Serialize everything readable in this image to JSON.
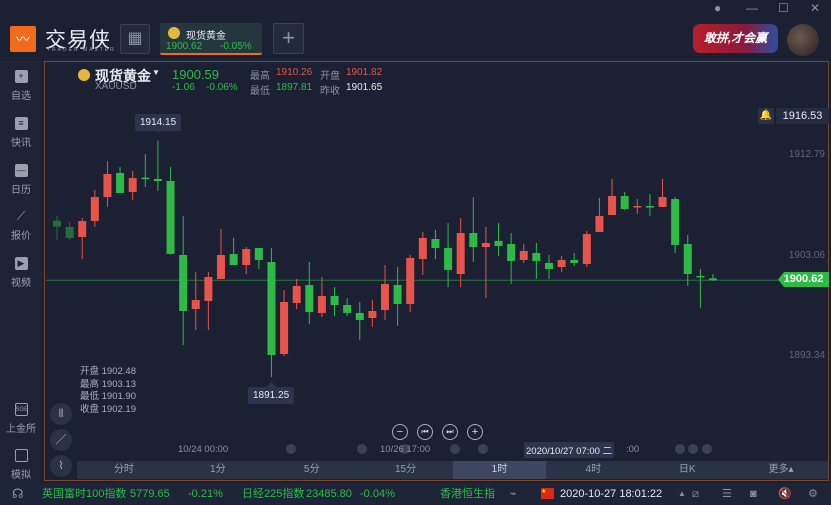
{
  "app": {
    "brand": "交易侠",
    "brand_sub": "TRADER MASTER",
    "banner": "敢拼,才会赢"
  },
  "tab": {
    "name": "现货黄金",
    "price": "1900.62",
    "change": "-0.05%"
  },
  "sidebar": {
    "items": [
      {
        "label": "自选",
        "icon": "bookmark-icon"
      },
      {
        "label": "快讯",
        "icon": "news-icon"
      },
      {
        "label": "日历",
        "icon": "calendar-icon"
      },
      {
        "label": "报价",
        "icon": "quote-icon"
      },
      {
        "label": "视频",
        "icon": "video-icon"
      },
      {
        "label": "上金所",
        "icon": "sge-icon"
      },
      {
        "label": "模拟",
        "icon": "wallet-icon"
      }
    ]
  },
  "quote": {
    "name": "现货黄金",
    "symbol": "XAUUSD",
    "price": "1900.59",
    "change": "-1.06",
    "change_pct": "-0.06%",
    "high_label": "最高",
    "high": "1910.26",
    "open_label": "开盘",
    "open": "1901.82",
    "low_label": "最低",
    "low": "1897.81",
    "prev_label": "昨收",
    "prev": "1901.65"
  },
  "ohlc_panel": {
    "open": "开盘 1902.48",
    "high": "最高 1903.13",
    "low": "最低 1901.90",
    "close": "收盘 1902.19"
  },
  "chart_data": {
    "type": "candlestick",
    "y_ticks": [
      "1912.79",
      "1903.06",
      "1893.34"
    ],
    "y_tick_values": [
      1912.79,
      1903.06,
      1893.34
    ],
    "top_label": "1916.53",
    "current_price": "1900.62",
    "max_label": "1914.15",
    "min_label": "1891.25",
    "x_labels": [
      "10/24 00:00",
      "10/26 17:00"
    ],
    "crosshair_time": "2020/10/27 07:00 二",
    "crosshair_tail": ":00",
    "colors": {
      "up": "#e8534a",
      "down": "#2dbb45"
    },
    "candles": [
      [
        1906.38,
        1906.84,
        1904.51,
        1905.8
      ],
      [
        1905.77,
        1906.25,
        1904.51,
        1904.71
      ],
      [
        1904.8,
        1906.64,
        1902.67,
        1906.35
      ],
      [
        1906.35,
        1909.35,
        1905.77,
        1908.67
      ],
      [
        1908.67,
        1912.16,
        1907.71,
        1910.9
      ],
      [
        1911.0,
        1911.58,
        1909.06,
        1909.06
      ],
      [
        1909.16,
        1911.19,
        1908.38,
        1910.51
      ],
      [
        1910.55,
        1912.84,
        1909.64,
        1910.51
      ],
      [
        1910.42,
        1914.15,
        1909.26,
        1910.22
      ],
      [
        1910.22,
        1911.58,
        1903.1,
        1903.16
      ],
      [
        1903.06,
        1906.84,
        1894.35,
        1897.64
      ],
      [
        1897.83,
        1901.41,
        1895.8,
        1898.7
      ],
      [
        1898.61,
        1901.41,
        1895.8,
        1900.93
      ],
      [
        1900.74,
        1905.58,
        1900.74,
        1903.06
      ],
      [
        1903.16,
        1904.71,
        1902.09,
        1902.09
      ],
      [
        1902.09,
        1903.83,
        1901.22,
        1903.64
      ],
      [
        1903.74,
        1903.74,
        1901.7,
        1902.58
      ],
      [
        1902.38,
        1903.74,
        1891.25,
        1893.38
      ],
      [
        1893.48,
        1899.67,
        1893.28,
        1898.51
      ],
      [
        1898.41,
        1900.74,
        1897.83,
        1900.06
      ],
      [
        1900.16,
        1902.38,
        1896.38,
        1897.54
      ],
      [
        1897.45,
        1900.93,
        1897.06,
        1899.09
      ],
      [
        1899.09,
        1899.96,
        1897.15,
        1898.22
      ],
      [
        1898.22,
        1898.9,
        1897.15,
        1897.45
      ],
      [
        1897.45,
        1898.51,
        1894.83,
        1896.77
      ],
      [
        1896.96,
        1898.7,
        1896.09,
        1897.64
      ],
      [
        1897.74,
        1902.09,
        1896.77,
        1900.25
      ],
      [
        1900.16,
        1901.9,
        1896.19,
        1898.32
      ],
      [
        1898.32,
        1903.06,
        1897.54,
        1902.77
      ],
      [
        1902.67,
        1905.29,
        1901.12,
        1904.71
      ],
      [
        1904.61,
        1905.48,
        1902.67,
        1903.74
      ],
      [
        1903.74,
        1906.16,
        1899.96,
        1901.61
      ],
      [
        1901.22,
        1906.64,
        1899.96,
        1905.19
      ],
      [
        1905.19,
        1908.67,
        1902.38,
        1903.83
      ],
      [
        1903.83,
        1905.77,
        1898.9,
        1904.22
      ],
      [
        1904.42,
        1906.16,
        1902.96,
        1903.93
      ],
      [
        1904.12,
        1905.19,
        1900.25,
        1902.48
      ],
      [
        1902.58,
        1904.12,
        1902.29,
        1903.45
      ],
      [
        1903.25,
        1904.22,
        1900.74,
        1902.48
      ],
      [
        1902.29,
        1903.06,
        1900.74,
        1901.7
      ],
      [
        1901.9,
        1902.96,
        1901.41,
        1902.58
      ],
      [
        1902.58,
        1903.25,
        1902.0,
        1902.29
      ],
      [
        1902.19,
        1905.38,
        1901.9,
        1905.09
      ],
      [
        1905.29,
        1908.58,
        1905.29,
        1906.84
      ],
      [
        1906.93,
        1910.42,
        1906.93,
        1908.77
      ],
      [
        1908.77,
        1909.16,
        1907.42,
        1907.51
      ],
      [
        1907.78,
        1908.48,
        1907.03,
        1907.8
      ],
      [
        1907.8,
        1908.96,
        1906.84,
        1907.76
      ],
      [
        1907.71,
        1910.42,
        1907.71,
        1908.67
      ],
      [
        1908.48,
        1908.67,
        1903.25,
        1904.03
      ],
      [
        1904.12,
        1905.0,
        1900.06,
        1901.22
      ],
      [
        1901.03,
        1901.7,
        1897.93,
        1900.93
      ],
      [
        1900.8,
        1901.22,
        1900.55,
        1900.62
      ]
    ]
  },
  "timeframes": [
    {
      "label": "分时"
    },
    {
      "label": "1分"
    },
    {
      "label": "5分"
    },
    {
      "label": "15分"
    },
    {
      "label": "1时",
      "active": true
    },
    {
      "label": "4时"
    },
    {
      "label": "日K"
    },
    {
      "label": "更多▴"
    }
  ],
  "status": {
    "ticker1_name": "英国富时100指数",
    "ticker1_value": "5779.65",
    "ticker1_change": "-0.21%",
    "ticker2_name": "日经225指数",
    "ticker2_value": "23485.80",
    "ticker2_change": "-0.04%",
    "ticker3_name": "香港恒生指数",
    "datetime": "2020-10-27 18:01:22"
  }
}
